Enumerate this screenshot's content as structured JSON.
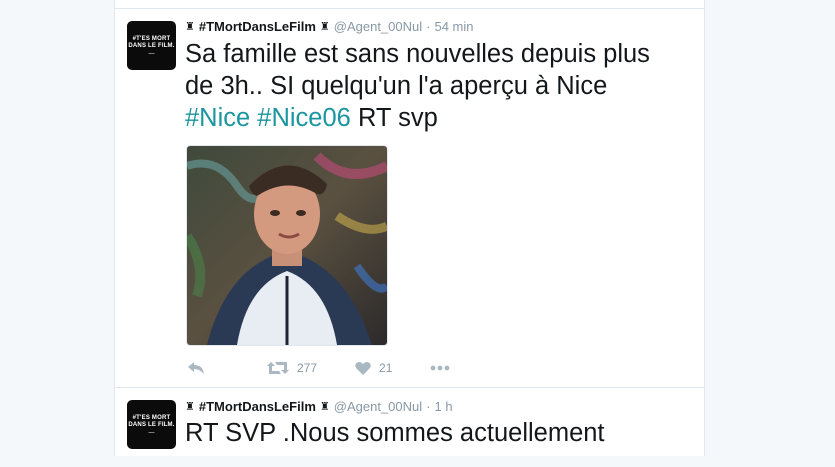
{
  "tweets": [
    {
      "avatar_text": [
        "#T'ES MORT",
        "DANS LE FILM."
      ],
      "name": "#TMortDansLeFilm",
      "handle": "@Agent_00Nul",
      "time": "54 min",
      "text_lines": [
        "Sa famille est sans nouvelles depuis plus",
        "de 3h.. SI quelqu'un l'a aperçu à Nice"
      ],
      "hashtags": [
        "#Nice",
        "#Nice06"
      ],
      "text_tail": "RT svp",
      "retweets": "277",
      "likes": "21"
    },
    {
      "avatar_text": [
        "#T'ES MORT",
        "DANS LE FILM."
      ],
      "name": "#TMortDansLeFilm",
      "handle": "@Agent_00Nul",
      "time": "1 h",
      "text_lines": [
        "RT SVP .Nous sommes actuellement"
      ]
    }
  ],
  "icons": [
    "crown-icon",
    "reply-icon",
    "retweet-icon",
    "like-icon",
    "more-icon"
  ],
  "colors": {
    "hashtag": "#1b95a0",
    "muted": "#8899a6",
    "border": "#e1e8ed"
  }
}
